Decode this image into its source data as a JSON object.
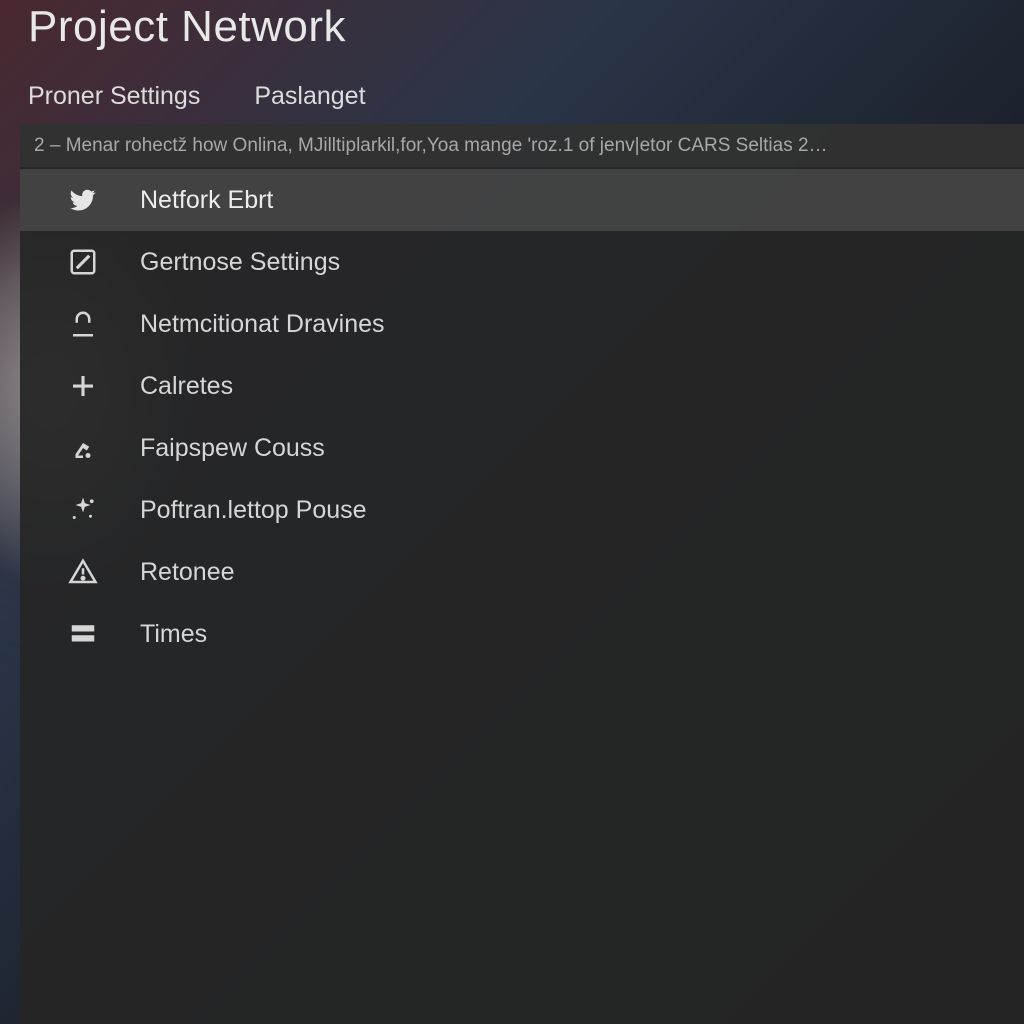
{
  "header": {
    "title": "Project Network"
  },
  "tabs": [
    {
      "id": "proner-settings",
      "label": "Proner Settings"
    },
    {
      "id": "paslanget",
      "label": "Paslanget"
    }
  ],
  "info_bar": "2 – Menar rohectž how Onlina, MJilltiplarkil,for,Yoa mange 'roz.1 of jenv|etor CARS Seltias 2…",
  "menu": {
    "items": [
      {
        "id": "netfork-ebrt",
        "icon": "bird-icon",
        "label": "Netfork Ebrt",
        "selected": true
      },
      {
        "id": "gertnose-settings",
        "icon": "pencil-icon",
        "label": "Gertnose Settings",
        "selected": false
      },
      {
        "id": "netmcitionat-dravines",
        "icon": "lock-icon",
        "label": "Netmcitionat Dravines",
        "selected": false
      },
      {
        "id": "calretes",
        "icon": "plus-icon",
        "label": "Calretes",
        "selected": false
      },
      {
        "id": "faipspew-couss",
        "icon": "robot-arm-icon",
        "label": "Faipspew Couss",
        "selected": false
      },
      {
        "id": "poftran-lettop-pouse",
        "icon": "sparkle-icon",
        "label": "Poftran.lettop Pouse",
        "selected": false
      },
      {
        "id": "retonee",
        "icon": "warning-icon",
        "label": "Retonee",
        "selected": false
      },
      {
        "id": "times",
        "icon": "rows-icon",
        "label": "Times",
        "selected": false
      }
    ]
  },
  "icons": {
    "bird-icon": "bird",
    "pencil-icon": "pencil",
    "lock-icon": "lock",
    "plus-icon": "plus",
    "robot-arm-icon": "robot-arm",
    "sparkle-icon": "sparkle",
    "warning-icon": "warning",
    "rows-icon": "rows"
  }
}
